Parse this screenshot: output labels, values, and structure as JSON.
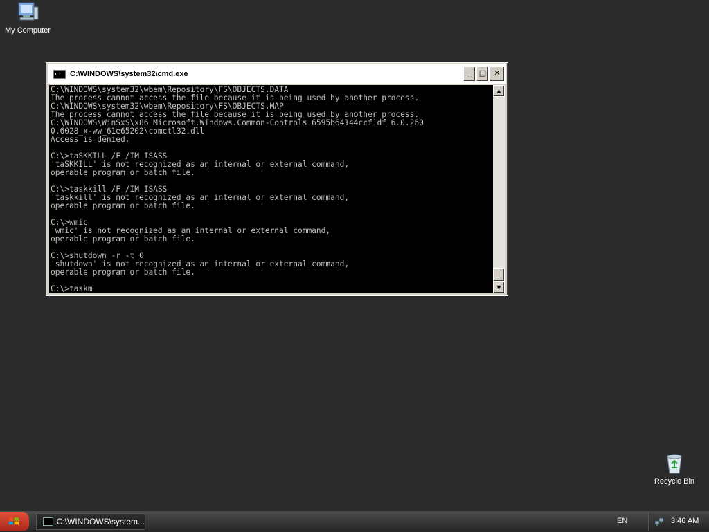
{
  "desktop": {
    "icons": [
      {
        "label": "My Computer"
      },
      {
        "label": "Recycle Bin"
      }
    ]
  },
  "window": {
    "title": "C:\\WINDOWS\\system32\\cmd.exe",
    "buttons": {
      "minimize": "_",
      "maximize": "□",
      "close": "✕"
    }
  },
  "console": {
    "text": "C:\\WINDOWS\\system32\\wbem\\Repository\\FS\\OBJECTS.DATA\nThe process cannot access the file because it is being used by another process.\nC:\\WINDOWS\\system32\\wbem\\Repository\\FS\\OBJECTS.MAP\nThe process cannot access the file because it is being used by another process.\nC:\\WINDOWS\\WinSxS\\x86_Microsoft.Windows.Common-Controls_6595b64144ccf1df_6.0.260\n0.6028_x-ww_61e65202\\comctl32.dll\nAccess is denied.\n\nC:\\>taSKKILL /F /IM ISASS\n'taSKKILL' is not recognized as an internal or external command,\noperable program or batch file.\n\nC:\\>taskkill /F /IM ISASS\n'taskkill' is not recognized as an internal or external command,\noperable program or batch file.\n\nC:\\>wmic\n'wmic' is not recognized as an internal or external command,\noperable program or batch file.\n\nC:\\>shutdown -r -t 0\n'shutdown' is not recognized as an internal or external command,\noperable program or batch file.\n\nC:\\>taskm"
  },
  "taskbar": {
    "task_label": "C:\\WINDOWS\\system...",
    "language": "EN",
    "clock": "3:46 AM"
  },
  "colors": {
    "desktop_bg": "#2b2b2b",
    "console_bg": "#000000",
    "console_text": "#c0c0c0"
  },
  "icons": [
    "my-computer-icon",
    "recycle-bin-icon",
    "cmd-icon",
    "windows-flag-icon",
    "network-icon",
    "scroll-up-icon",
    "scroll-down-icon"
  ]
}
